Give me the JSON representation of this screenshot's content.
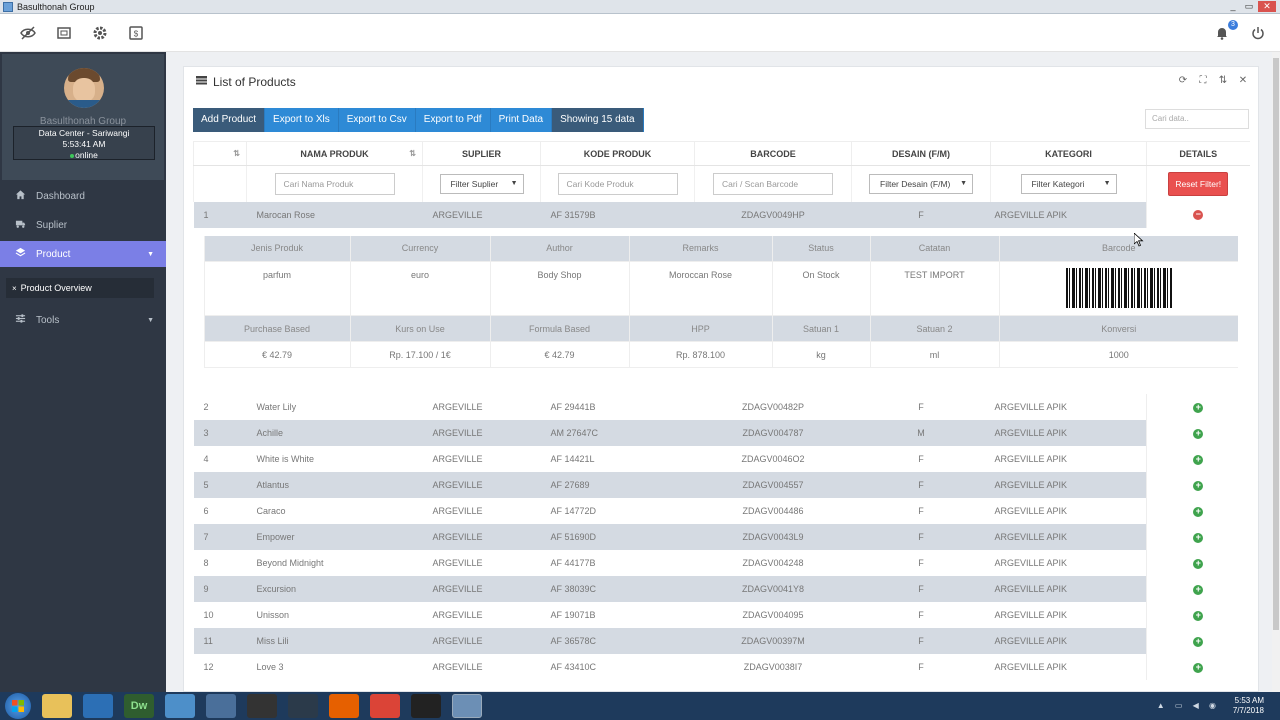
{
  "window": {
    "title": "Basulthonah Group",
    "controls": [
      "_",
      "▭",
      "✕"
    ]
  },
  "header": {
    "notification_count": "3"
  },
  "sidebar": {
    "profile_name": "Basulthonah Group",
    "location": "Data Center - Sariwangi",
    "time": "5:53:41 AM",
    "status": "online",
    "items": [
      {
        "label": "Dashboard",
        "icon": "home-icon"
      },
      {
        "label": "Suplier",
        "icon": "truck-icon"
      },
      {
        "label": "Product",
        "icon": "layers-icon"
      },
      {
        "label": "Tools",
        "icon": "sliders-icon"
      }
    ],
    "submenu_label": "Product Overview"
  },
  "panel": {
    "title": "List of Products",
    "buttons": [
      "Add Product",
      "Export to Xls",
      "Export to Csv",
      "Export to Pdf",
      "Print Data",
      "Showing 15 data"
    ],
    "search_placeholder": "Cari data.."
  },
  "table": {
    "columns": [
      "",
      "NAMA PRODUK",
      "SUPLIER",
      "KODE PRODUK",
      "BARCODE",
      "DESAIN (F/M)",
      "KATEGORI",
      "DETAILS"
    ],
    "filters": {
      "name": "Cari Nama Produk",
      "supplier": "Filter Suplier",
      "kode": "Cari Kode Produk",
      "barcode": "Cari / Scan Barcode",
      "desain": "Filter Desain (F/M)",
      "kategori": "Filter Kategori",
      "reset": "Reset Filter!"
    },
    "rows": [
      {
        "no": "1",
        "name": "Marocan Rose",
        "supplier": "ARGEVILLE",
        "kode": "AF 31579B",
        "barcode": "ZDAGV0049HP",
        "desain": "F",
        "kategori": "ARGEVILLE APIK"
      },
      {
        "no": "2",
        "name": "Water Lily",
        "supplier": "ARGEVILLE",
        "kode": "AF 29441B",
        "barcode": "ZDAGV00482P",
        "desain": "F",
        "kategori": "ARGEVILLE APIK"
      },
      {
        "no": "3",
        "name": "Achille",
        "supplier": "ARGEVILLE",
        "kode": "AM 27647C",
        "barcode": "ZDAGV004787",
        "desain": "M",
        "kategori": "ARGEVILLE APIK"
      },
      {
        "no": "4",
        "name": "White is White",
        "supplier": "ARGEVILLE",
        "kode": "AF 14421L",
        "barcode": "ZDAGV0046O2",
        "desain": "F",
        "kategori": "ARGEVILLE APIK"
      },
      {
        "no": "5",
        "name": "Atlantus",
        "supplier": "ARGEVILLE",
        "kode": "AF 27689",
        "barcode": "ZDAGV004557",
        "desain": "F",
        "kategori": "ARGEVILLE APIK"
      },
      {
        "no": "6",
        "name": "Caraco",
        "supplier": "ARGEVILLE",
        "kode": "AF 14772D",
        "barcode": "ZDAGV004486",
        "desain": "F",
        "kategori": "ARGEVILLE APIK"
      },
      {
        "no": "7",
        "name": "Empower",
        "supplier": "ARGEVILLE",
        "kode": "AF 51690D",
        "barcode": "ZDAGV0043L9",
        "desain": "F",
        "kategori": "ARGEVILLE APIK"
      },
      {
        "no": "8",
        "name": "Beyond Midnight",
        "supplier": "ARGEVILLE",
        "kode": "AF 44177B",
        "barcode": "ZDAGV004248",
        "desain": "F",
        "kategori": "ARGEVILLE APIK"
      },
      {
        "no": "9",
        "name": "Excursion",
        "supplier": "ARGEVILLE",
        "kode": "AF 38039C",
        "barcode": "ZDAGV0041Y8",
        "desain": "F",
        "kategori": "ARGEVILLE APIK"
      },
      {
        "no": "10",
        "name": "Unisson",
        "supplier": "ARGEVILLE",
        "kode": "AF 19071B",
        "barcode": "ZDAGV004095",
        "desain": "F",
        "kategori": "ARGEVILLE APIK"
      },
      {
        "no": "11",
        "name": "Miss Lili",
        "supplier": "ARGEVILLE",
        "kode": "AF 36578C",
        "barcode": "ZDAGV00397M",
        "desain": "F",
        "kategori": "ARGEVILLE APIK"
      },
      {
        "no": "12",
        "name": "Love 3",
        "supplier": "ARGEVILLE",
        "kode": "AF 43410C",
        "barcode": "ZDAGV0038I7",
        "desain": "F",
        "kategori": "ARGEVILLE APIK"
      }
    ]
  },
  "detail": {
    "h1": [
      "Jenis Produk",
      "Currency",
      "Author",
      "Remarks",
      "Status",
      "Catatan",
      "Barcode"
    ],
    "v1": [
      "parfum",
      "euro",
      "Body Shop",
      "Moroccan Rose",
      "On Stock",
      "TEST IMPORT"
    ],
    "h2": [
      "Purchase Based",
      "Kurs on Use",
      "Formula Based",
      "HPP",
      "Satuan 1",
      "Satuan 2",
      "Konversi"
    ],
    "v2": [
      "€ 42.79",
      "Rp. 17.100 / 1€",
      "€ 42.79",
      "Rp. 878.100",
      "kg",
      "ml",
      "1000"
    ]
  },
  "taskbar": {
    "time": "5:53 AM",
    "date": "7/7/2018",
    "apps": [
      "Dw"
    ]
  }
}
